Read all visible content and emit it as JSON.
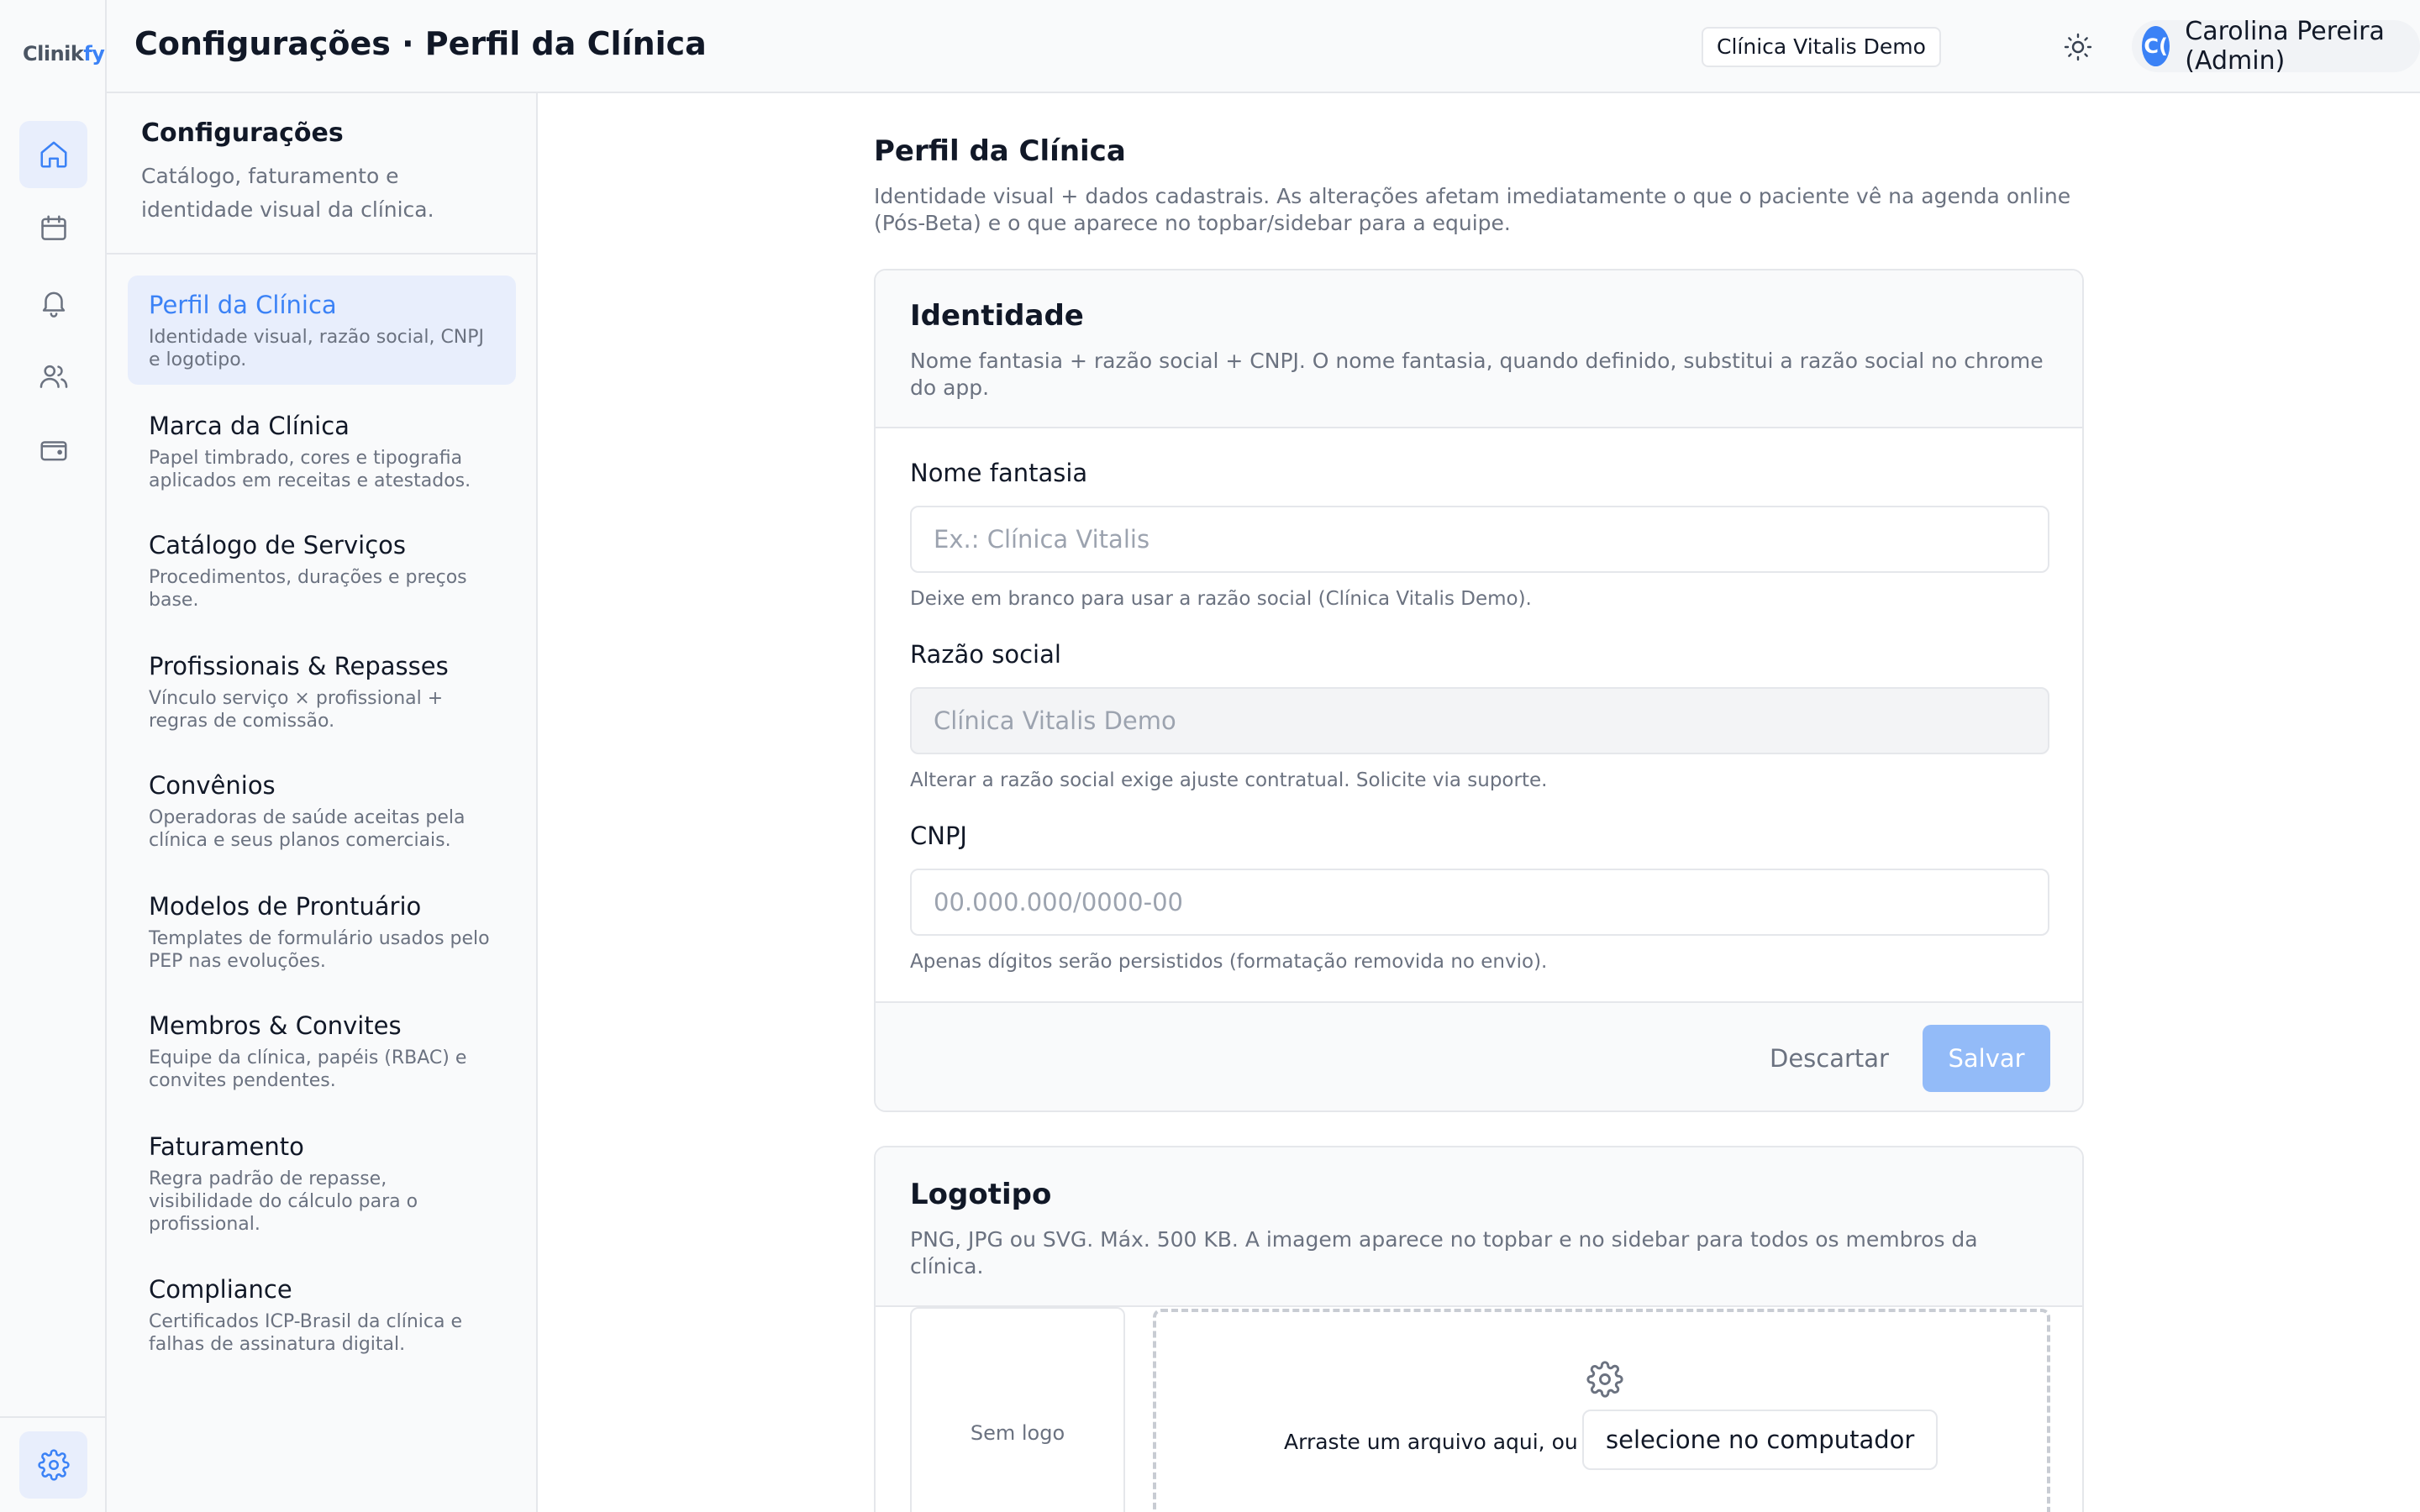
{
  "app": {
    "logo_prefix": "Clinik",
    "logo_suffix": "fy",
    "page_title": "Configurações · Perfil da Clínica",
    "clinic": "Clínica Vitalis Demo",
    "user_initials": "C(",
    "user_name": "Carolina Pereira (Admin)",
    "accent_color": "#3b82f6"
  },
  "rail": {
    "items": [
      "home-icon",
      "calendar-icon",
      "bell-icon",
      "users-icon",
      "wallet-icon"
    ],
    "bottom": "gear-icon"
  },
  "settings": {
    "title": "Configurações",
    "subtitle": "Catálogo, faturamento e identidade visual da clínica.",
    "items": [
      {
        "title": "Perfil da Clínica",
        "desc": "Identidade visual, razão social, CNPJ e logotipo."
      },
      {
        "title": "Marca da Clínica",
        "desc": "Papel timbrado, cores e tipografia aplicados em receitas e atestados."
      },
      {
        "title": "Catálogo de Serviços",
        "desc": "Procedimentos, durações e preços base."
      },
      {
        "title": "Profissionais & Repasses",
        "desc": "Vínculo serviço × profissional + regras de comissão."
      },
      {
        "title": "Convênios",
        "desc": "Operadoras de saúde aceitas pela clínica e seus planos comerciais."
      },
      {
        "title": "Modelos de Prontuário",
        "desc": "Templates de formulário usados pelo PEP nas evoluções."
      },
      {
        "title": "Membros & Convites",
        "desc": "Equipe da clínica, papéis (RBAC) e convites pendentes."
      },
      {
        "title": "Faturamento",
        "desc": "Regra padrão de repasse, visibilidade do cálculo para o profissional."
      },
      {
        "title": "Compliance",
        "desc": "Certificados ICP-Brasil da clínica e falhas de assinatura digital."
      }
    ]
  },
  "main": {
    "title": "Perfil da Clínica",
    "desc": "Identidade visual + dados cadastrais. As alterações afetam imediatamente o que o paciente vê na agenda online (Pós-Beta) e o que aparece no topbar/sidebar para a equipe."
  },
  "identity": {
    "title": "Identidade",
    "desc": "Nome fantasia + razão social + CNPJ. O nome fantasia, quando definido, substitui a razão social no chrome do app.",
    "trade_name_label": "Nome fantasia",
    "trade_name_placeholder": "Ex.: Clínica Vitalis",
    "trade_name_hint": "Deixe em branco para usar a razão social (Clínica Vitalis Demo).",
    "legal_name_label": "Razão social",
    "legal_name_value": "Clínica Vitalis Demo",
    "legal_name_hint": "Alterar a razão social exige ajuste contratual. Solicite via suporte.",
    "cnpj_label": "CNPJ",
    "cnpj_placeholder": "00.000.000/0000-00",
    "cnpj_hint": "Apenas dígitos serão persistidos (formatação removida no envio).",
    "discard": "Descartar",
    "save": "Salvar"
  },
  "logo_card": {
    "title": "Logotipo",
    "desc": "PNG, JPG ou SVG. Máx. 500 KB. A imagem aparece no topbar e no sidebar para todos os membros da clínica.",
    "preview": "Sem logo",
    "drop_text": "Arraste um arquivo aqui, ou",
    "select_button": "selecione no computador"
  }
}
